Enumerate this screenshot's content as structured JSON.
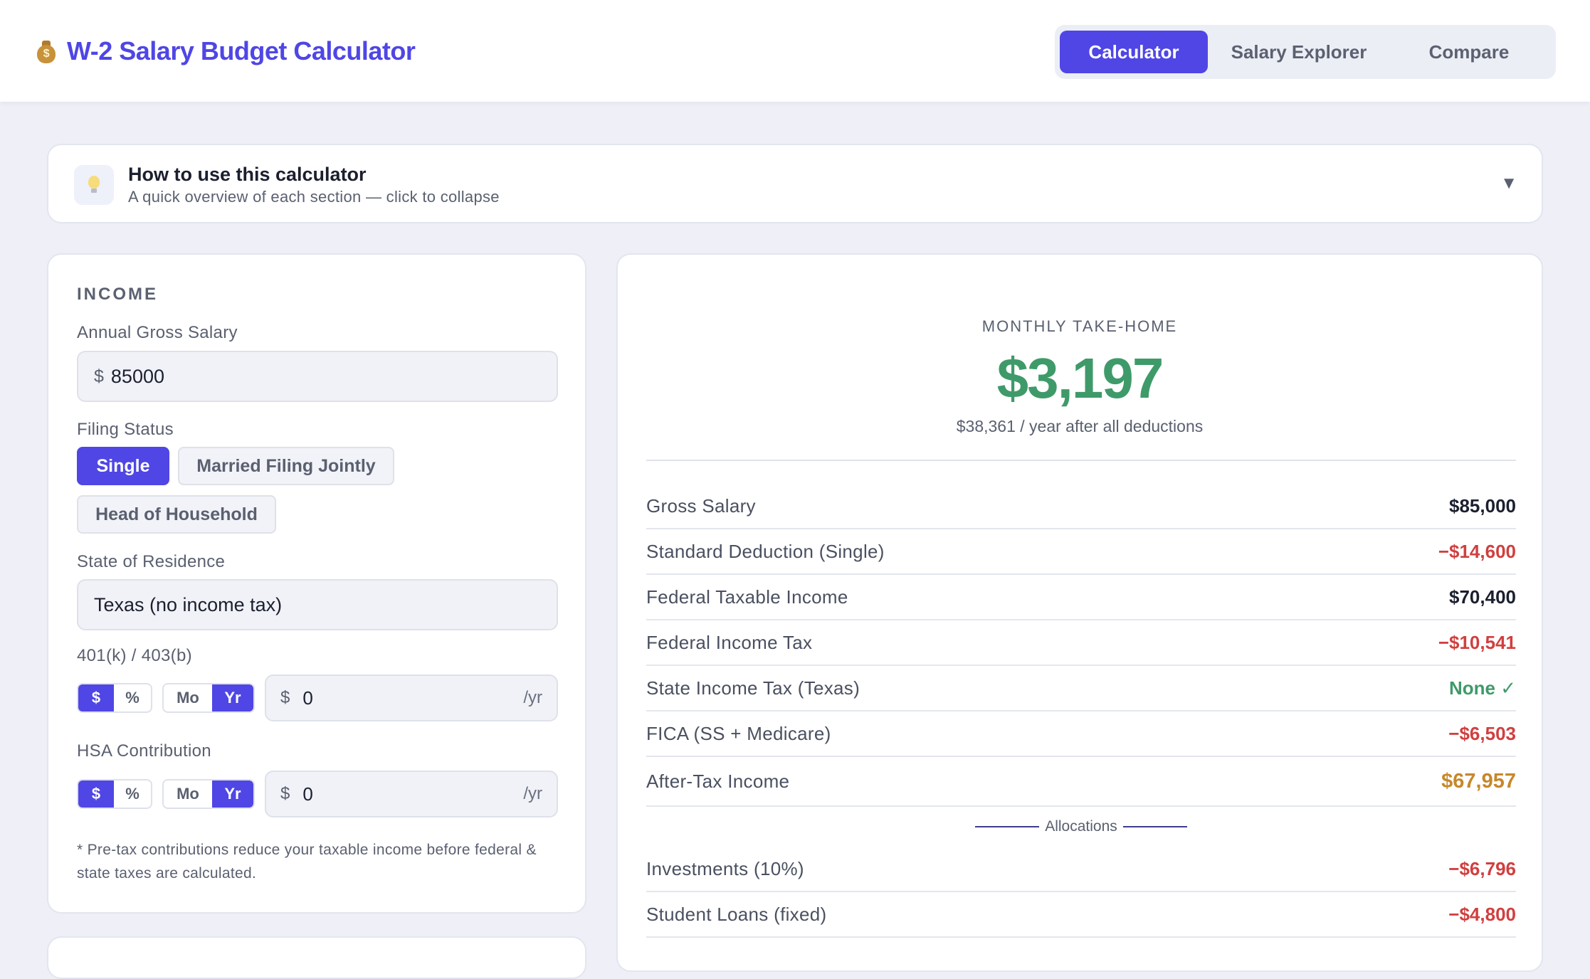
{
  "header": {
    "title": "W-2 Salary Budget Calculator",
    "icon": "money-bag-icon",
    "icon_text": "$",
    "tabs": [
      {
        "label": "Calculator",
        "active": true
      },
      {
        "label": "Salary Explorer",
        "active": false
      },
      {
        "label": "Compare",
        "active": false
      }
    ]
  },
  "help": {
    "icon": "lightbulb-icon",
    "title": "How to use this calculator",
    "subtitle": "A quick overview of each section — click to collapse",
    "chevron": "▼"
  },
  "income": {
    "section_title": "INCOME",
    "salary_label": "Annual Gross Salary",
    "salary_currency": "$",
    "salary_value": "85000",
    "filing_label": "Filing Status",
    "filing_options": [
      "Single",
      "Married Filing Jointly",
      "Head of Household"
    ],
    "filing_selected": "Single",
    "state_label": "State of Residence",
    "state_value": "Texas (no income tax)",
    "k401": {
      "label": "401(k) / 403(b)",
      "mode_dollar": "$",
      "mode_percent": "%",
      "period_mo": "Mo",
      "period_yr": "Yr",
      "currency": "$",
      "value": "0",
      "suffix": "/yr"
    },
    "hsa": {
      "label": "HSA Contribution",
      "mode_dollar": "$",
      "mode_percent": "%",
      "period_mo": "Mo",
      "period_yr": "Yr",
      "currency": "$",
      "value": "0",
      "suffix": "/yr"
    },
    "footnote": "* Pre-tax contributions reduce your taxable income before federal & state taxes are calculated."
  },
  "results": {
    "monthly_label": "MONTHLY TAKE-HOME",
    "monthly_value": "$3,197",
    "yearly_note": "$38,361 / year after all deductions",
    "rows": [
      {
        "label": "Gross Salary",
        "value": "$85,000",
        "tone": "dark"
      },
      {
        "label": "Standard Deduction (Single)",
        "value": "−$14,600",
        "tone": "red"
      },
      {
        "label": "Federal Taxable Income",
        "value": "$70,400",
        "tone": "dark"
      },
      {
        "label": "Federal Income Tax",
        "value": "−$10,541",
        "tone": "red"
      },
      {
        "label": "State Income Tax (Texas)",
        "value": "None ✓",
        "tone": "green"
      },
      {
        "label": "FICA (SS + Medicare)",
        "value": "−$6,503",
        "tone": "red"
      },
      {
        "label": "After-Tax Income",
        "value": "$67,957",
        "tone": "gold"
      }
    ],
    "allocations_label": "Allocations",
    "allocations": [
      {
        "label": "Investments (10%)",
        "value": "−$6,796",
        "tone": "red"
      },
      {
        "label": "Student Loans (fixed)",
        "value": "−$4,800",
        "tone": "red"
      }
    ]
  }
}
